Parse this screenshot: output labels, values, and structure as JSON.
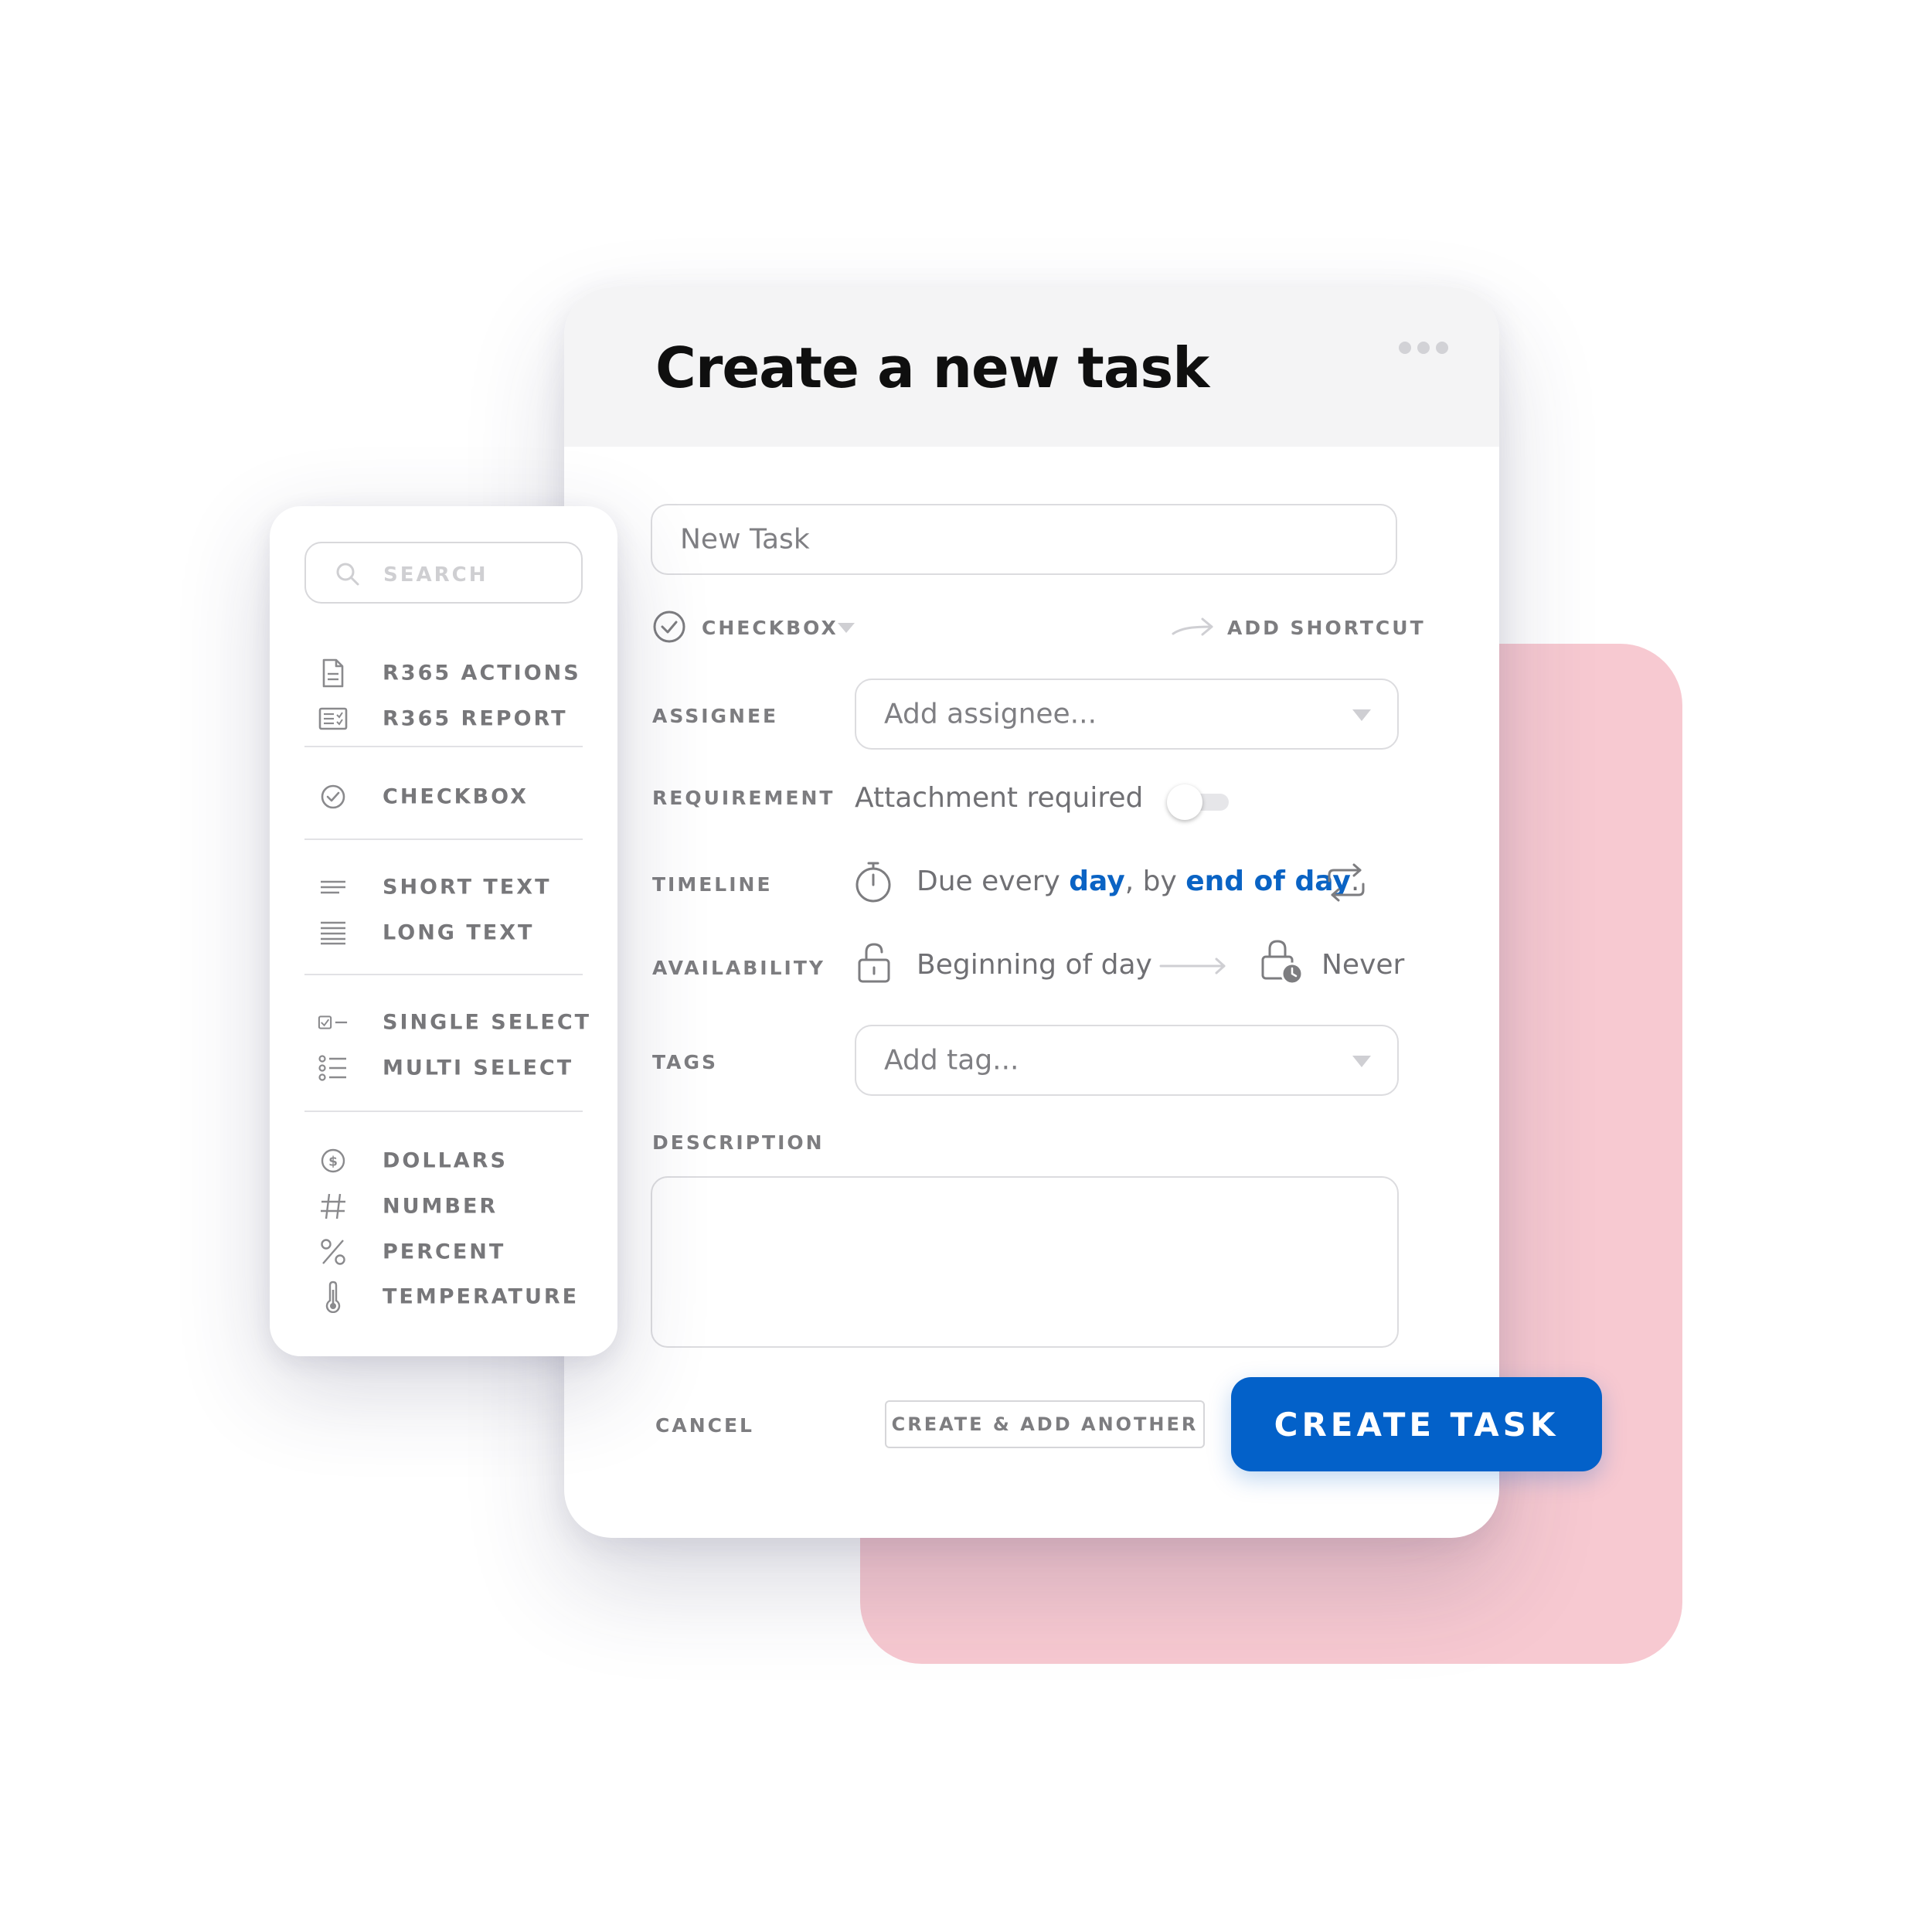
{
  "colors": {
    "accent": "#0361c9",
    "pink": "#f7c9d1",
    "header_bg": "#f4f4f5",
    "label_gray": "#7d7d80"
  },
  "dialog": {
    "title": "Create a new task",
    "more_icon": "more-horizontal-icon",
    "task_name": {
      "placeholder": "New Task"
    },
    "type": {
      "icon": "check-circle-icon",
      "label": "CHECKBOX"
    },
    "shortcut": {
      "icon": "arrow-right-icon",
      "label": "ADD SHORTCUT"
    },
    "assignee": {
      "label": "ASSIGNEE",
      "placeholder": "Add assignee..."
    },
    "requirement": {
      "label": "REQUIREMENT",
      "text": "Attachment required",
      "enabled": false
    },
    "timeline": {
      "label": "TIMELINE",
      "icon": "stopwatch-icon",
      "prefix": "Due every ",
      "frequency": "day",
      "middle": ", by ",
      "deadline": "end of day",
      "suffix": ".",
      "repeat_icon": "repeat-icon"
    },
    "availability": {
      "label": "AVAILABILITY",
      "start_icon": "unlock-icon",
      "start": "Beginning of day",
      "end_icon": "lock-clock-icon",
      "end": "Never"
    },
    "tags": {
      "label": "TAGS",
      "placeholder": "Add tag..."
    },
    "description": {
      "label": "DESCRIPTION",
      "value": ""
    },
    "actions": {
      "cancel": "CANCEL",
      "create_another": "CREATE & ADD ANOTHER",
      "create": "CREATE TASK"
    }
  },
  "side_panel": {
    "search_placeholder": "SEARCH",
    "groups": [
      [
        {
          "icon": "document-icon",
          "label": "R365 ACTIONS"
        },
        {
          "icon": "report-icon",
          "label": "R365 REPORT"
        }
      ],
      [
        {
          "icon": "check-circle-icon",
          "label": "CHECKBOX"
        }
      ],
      [
        {
          "icon": "short-text-icon",
          "label": "SHORT TEXT"
        },
        {
          "icon": "long-text-icon",
          "label": "LONG TEXT"
        }
      ],
      [
        {
          "icon": "single-select-icon",
          "label": "SINGLE SELECT"
        },
        {
          "icon": "multi-select-icon",
          "label": "MULTI SELECT"
        }
      ],
      [
        {
          "icon": "dollar-icon",
          "label": "DOLLARS"
        },
        {
          "icon": "hash-icon",
          "label": "NUMBER"
        },
        {
          "icon": "percent-icon",
          "label": "PERCENT"
        },
        {
          "icon": "thermometer-icon",
          "label": "TEMPERATURE"
        }
      ]
    ]
  }
}
